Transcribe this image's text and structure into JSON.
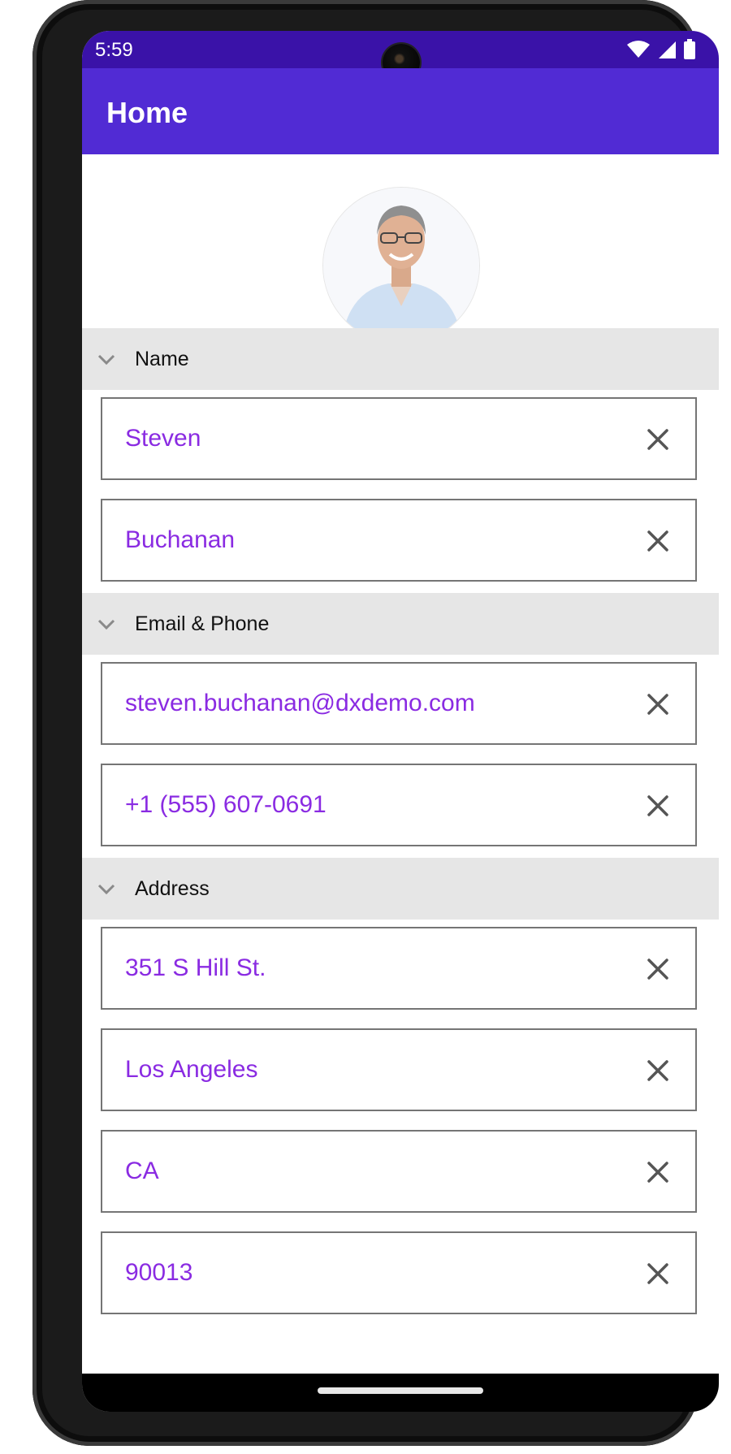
{
  "status": {
    "time": "5:59"
  },
  "appbar": {
    "title": "Home"
  },
  "groups": [
    {
      "label": "Name",
      "fields": [
        "Steven",
        "Buchanan"
      ]
    },
    {
      "label": "Email & Phone",
      "fields": [
        "steven.buchanan@dxdemo.com",
        "+1 (555) 607-0691"
      ]
    },
    {
      "label": "Address",
      "fields": [
        "351 S Hill St.",
        "Los Angeles",
        "CA",
        "90013"
      ]
    }
  ],
  "colors": {
    "statusbar": "#3a12a8",
    "appbar": "#512bd4",
    "field_text": "#8a2be2",
    "group_header": "#e6e6e6"
  },
  "icons": {
    "expand": "chevron-down-icon",
    "clear": "close-icon",
    "wifi": "wifi-icon",
    "signal": "signal-icon",
    "battery": "battery-icon"
  }
}
